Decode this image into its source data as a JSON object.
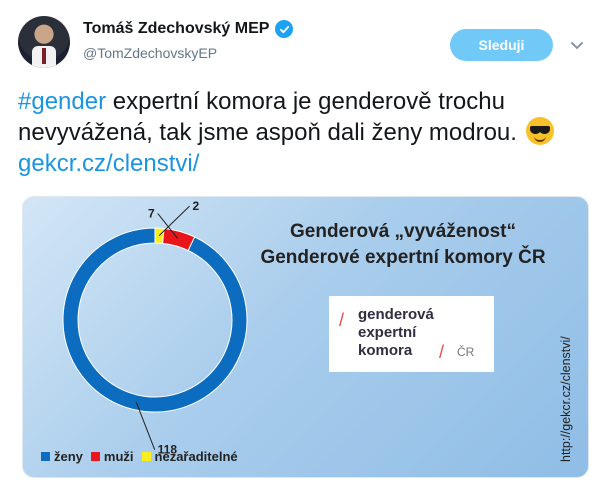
{
  "tweet": {
    "author_name": "Tomáš Zdechovský MEP",
    "handle": "@TomZdechovskyEP",
    "follow_label": "Sleduji",
    "hashtag": "#gender",
    "text_part1": " expertní komora je genderově trochu nevyvážená, tak jsme aspoň dali ženy modrou. ",
    "link_text": "gekcr.cz/clenstvi/"
  },
  "media": {
    "title_line1": "Genderová „vyváženost“",
    "title_line2": "Genderové expertní komory ČR",
    "logo": {
      "line1": "genderová",
      "line2": "expertní",
      "line3": "komora",
      "slash": "/",
      "suffix": "ČR"
    },
    "vertical_url": "http://gekcr.cz/clenstvi/"
  },
  "colors": {
    "accent": "#1da1f2",
    "link": "#1b95e0",
    "follow_bg": "#71c9f8"
  },
  "chart_data": {
    "type": "pie",
    "style": "donut",
    "categories": [
      "ženy",
      "muži",
      "nezařaditelné"
    ],
    "values": [
      118,
      7,
      2
    ],
    "colors": [
      "#0b6cc0",
      "#e8151b",
      "#f9ee1d"
    ],
    "data_labels": [
      "118",
      "7",
      "2"
    ],
    "legend_position": "bottom-left"
  }
}
